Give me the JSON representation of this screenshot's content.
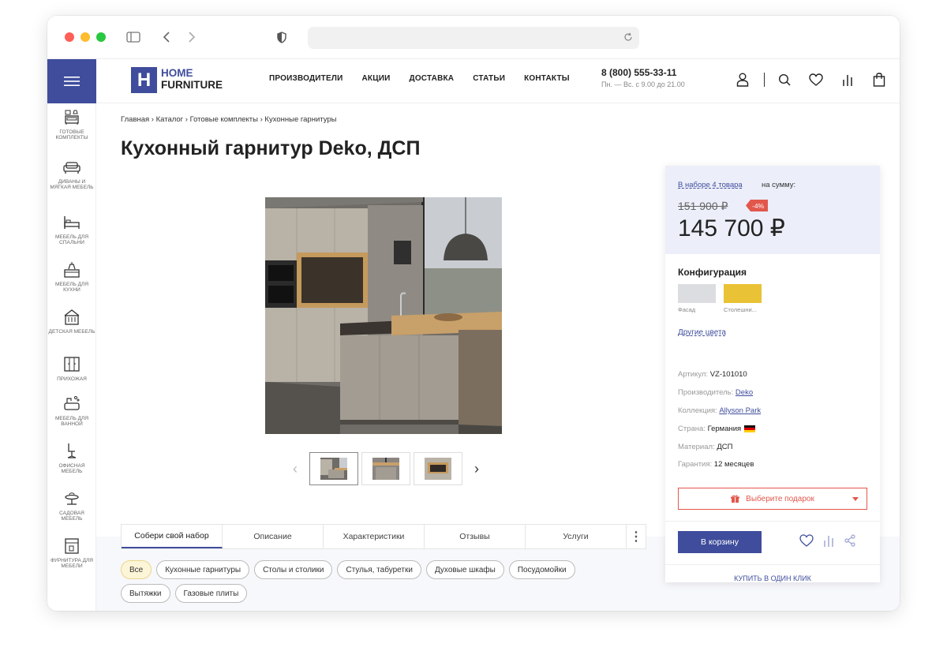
{
  "browser": {
    "controls": [
      "close-dot",
      "minimize-dot",
      "zoom-dot"
    ],
    "icons": [
      "sidebar-icon",
      "back-icon",
      "forward-icon",
      "shield-icon",
      "reload-icon"
    ]
  },
  "rail": {
    "items": [
      {
        "label": "Готовые комплекты",
        "icon": "furniture-set-icon"
      },
      {
        "label": "Диваны и мягкая мебель",
        "icon": "sofa-icon"
      },
      {
        "label": "Мебель для спальни",
        "icon": "bed-icon"
      },
      {
        "label": "Мебель для кухни",
        "icon": "kitchen-icon"
      },
      {
        "label": "Детская мебель",
        "icon": "kids-icon"
      },
      {
        "label": "Прихожая",
        "icon": "wardrobe-icon"
      },
      {
        "label": "Мебель для ванной",
        "icon": "bathroom-icon"
      },
      {
        "label": "Офисная мебель",
        "icon": "office-chair-icon"
      },
      {
        "label": "Садовая мебель",
        "icon": "garden-icon"
      },
      {
        "label": "Фурнитура для мебели",
        "icon": "hardware-icon"
      }
    ]
  },
  "header": {
    "logo_line1": "HOME",
    "logo_line2": "FURNITURE",
    "logo_letter": "H",
    "nav": [
      "Производители",
      "Акции",
      "Доставка",
      "Статьи",
      "Контакты"
    ],
    "phone": "8 (800) 555-33-11",
    "hours": "Пн. — Вс. с 9.00 до 21.00",
    "icons": [
      "user-icon",
      "search-icon",
      "heart-icon",
      "compare-icon",
      "bag-icon"
    ]
  },
  "breadcrumb": "Главная › Каталог › Готовые комплекты › Кухонные гарнитуры",
  "title": "Кухонный гарнитур Deko, ДСП",
  "tabs": [
    "Собери свой набор",
    "Описание",
    "Характеристики",
    "Отзывы",
    "Услуги"
  ],
  "tab_more": "⋮",
  "chips": [
    "Все",
    "Кухонные гарнитуры",
    "Столы и столики",
    "Стулья, табуретки",
    "Духовые шкафы",
    "Посудомойки",
    "Вытяжки",
    "Газовые плиты"
  ],
  "card": {
    "set_link": "В наборе 4 товара",
    "set_sum": "на сумму:",
    "old_price": "151 900 ₽",
    "discount": "-4%",
    "new_price": "145 700 ₽",
    "config_title": "Конфигурация",
    "swatches": [
      {
        "label": "Фасад",
        "color": "#dcdde0"
      },
      {
        "label": "Столешни...",
        "color": "#e9c235"
      }
    ],
    "other_colors": "Другие цвета",
    "specs": {
      "article_label": "Артикул:",
      "article": "VZ-101010",
      "maker_label": "Производитель:",
      "maker": "Deko",
      "collection_label": "Коллекция:",
      "collection": "Allyson Park",
      "country_label": "Страна:",
      "country": "Германия",
      "material_label": "Материал:",
      "material": "ДСП",
      "warranty_label": "Гарантия:",
      "warranty": "12 месяцев"
    },
    "gift": "Выберите подарок",
    "cart_button": "В корзину",
    "one_click": "Купить в один клик"
  },
  "colors": {
    "accent": "#3f4d9c",
    "sale": "#e2574c",
    "chip_active": "#fdf5d8"
  }
}
